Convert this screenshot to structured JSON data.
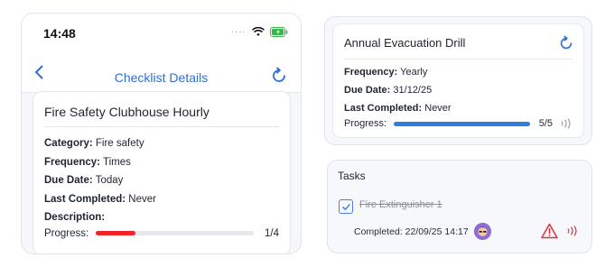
{
  "status_bar": {
    "time": "14:48"
  },
  "nav": {
    "title": "Checklist Details"
  },
  "checklist": {
    "title": "Fire Safety Clubhouse Hourly",
    "category_label": "Category:",
    "category": "Fire safety",
    "frequency_label": "Frequency:",
    "frequency": "Times",
    "due_label": "Due Date:",
    "due": "Today",
    "last_label": "Last Completed:",
    "last": "Never",
    "description_label": "Description:",
    "progress_label": "Progress:",
    "progress_count": "1/4",
    "progress_fraction": 0.25,
    "progress_color": "#f0252a"
  },
  "drill": {
    "title": "Annual Evacuation Drill",
    "frequency_label": "Frequency:",
    "frequency": "Yearly",
    "due_label": "Due Date:",
    "due": "31/12/25",
    "last_label": "Last Completed:",
    "last": "Never",
    "progress_label": "Progress:",
    "progress_count": "5/5",
    "progress_fraction": 1.0,
    "progress_color": "#2f7fd8"
  },
  "tasks": {
    "title": "Tasks",
    "items": [
      {
        "name": "Fire Extinguisher 1",
        "completed": "Completed: 22/09/25 14:17",
        "checked": true
      }
    ]
  },
  "colors": {
    "accent": "#2f6fd6",
    "warning": "#e0303a"
  }
}
